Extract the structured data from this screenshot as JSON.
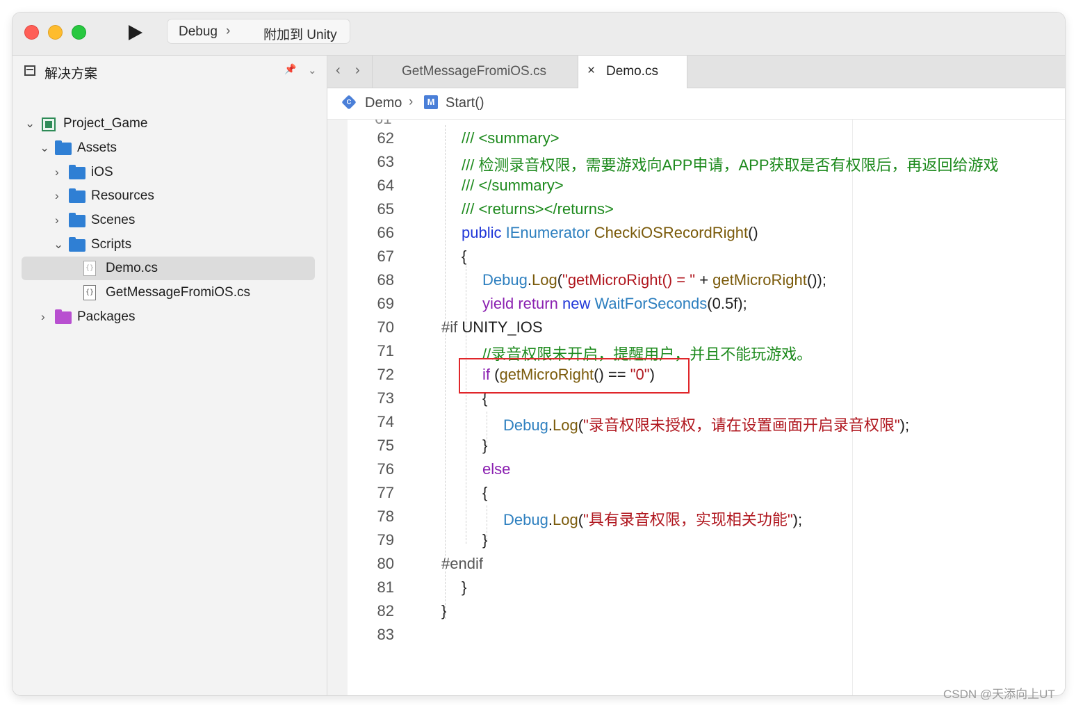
{
  "toolbar": {
    "configuration": "Debug",
    "separator": "›",
    "target": "附加到 Unity"
  },
  "sidebar": {
    "title": "解决方案",
    "tree": [
      {
        "label": "Project_Game",
        "kind": "project",
        "expanded": true
      },
      {
        "label": "Assets",
        "kind": "folder",
        "expanded": true
      },
      {
        "label": "iOS",
        "kind": "folder",
        "expanded": false
      },
      {
        "label": "Resources",
        "kind": "folder",
        "expanded": false
      },
      {
        "label": "Scenes",
        "kind": "folder",
        "expanded": false
      },
      {
        "label": "Scripts",
        "kind": "folder",
        "expanded": true
      },
      {
        "label": "Demo.cs",
        "kind": "file",
        "selected": true
      },
      {
        "label": "GetMessageFromiOS.cs",
        "kind": "file"
      },
      {
        "label": "Packages",
        "kind": "package",
        "expanded": false
      }
    ]
  },
  "tabs": [
    {
      "label": "GetMessageFromiOS.cs",
      "active": false
    },
    {
      "label": "Demo.cs",
      "active": true,
      "close": "×"
    }
  ],
  "breadcrumb": {
    "class_icon": "C",
    "class_name": "Demo",
    "method_icon": "M",
    "method_name": "Start()"
  },
  "code": {
    "lines": [
      {
        "n": "62",
        "text": "/// <summary>"
      },
      {
        "n": "63",
        "text": "/// 检测录音权限，需要游戏向APP申请，APP获取是否有权限后，再返回给游戏"
      },
      {
        "n": "64",
        "text": "/// </summary>"
      },
      {
        "n": "65",
        "text": "/// <returns></returns>"
      },
      {
        "n": "66",
        "text": "public IEnumerator CheckiOSRecordRight()"
      },
      {
        "n": "67",
        "text": "{"
      },
      {
        "n": "68",
        "text": "Debug.Log(\"getMicroRight() = \" + getMicroRight());"
      },
      {
        "n": "69",
        "text": "yield return new WaitForSeconds(0.5f);"
      },
      {
        "n": "70",
        "text": "#if UNITY_IOS"
      },
      {
        "n": "71",
        "text": "//录音权限未开启，提醒用户，并且不能玩游戏。"
      },
      {
        "n": "72",
        "text": "if (getMicroRight() == \"0\")"
      },
      {
        "n": "73",
        "text": "{"
      },
      {
        "n": "74",
        "text": "Debug.Log(\"录音权限未授权，请在设置画面开启录音权限\");"
      },
      {
        "n": "75",
        "text": "}"
      },
      {
        "n": "76",
        "text": "else"
      },
      {
        "n": "77",
        "text": "{"
      },
      {
        "n": "78",
        "text": "Debug.Log(\"具有录音权限，实现相关功能\");"
      },
      {
        "n": "79",
        "text": "}"
      },
      {
        "n": "80",
        "text": "#endif"
      },
      {
        "n": "81",
        "text": "}"
      },
      {
        "n": "82",
        "text": "}"
      },
      {
        "n": "83",
        "text": ""
      }
    ]
  },
  "tokens": {
    "l62": "/// <summary>",
    "l63": "/// 检测录音权限，需要游戏向APP申请，APP获取是否有权限后，再返回给游戏",
    "l64": "/// </summary>",
    "l65": "/// <returns></returns>",
    "l66_kw": "public",
    "l66_type": "IEnumerator",
    "l66_meth": "CheckiOSRecordRight",
    "l66_rest": "()",
    "l67": "{",
    "l68_type": "Debug",
    "l68_dot": ".",
    "l68_meth": "Log",
    "l68_p": "(",
    "l68_str": "\"getMicroRight() = \"",
    "l68_plus": " + ",
    "l68_meth2": "getMicroRight",
    "l68_end": "());",
    "l69_kw": "yield return",
    "l69_new": "new",
    "l69_type": "WaitForSeconds",
    "l69_end": "(0.5f);",
    "l70_pre": "#if",
    "l70_sym": " UNITY_IOS",
    "l71": "//录音权限未开启，提醒用户，并且不能玩游戏。",
    "l72_kw": "if",
    "l72_p": " (",
    "l72_meth": "getMicroRight",
    "l72_mid": "() == ",
    "l72_str": "\"0\"",
    "l72_end": ")",
    "l73": "{",
    "l74_type": "Debug",
    "l74_dot": ".",
    "l74_meth": "Log",
    "l74_p": "(",
    "l74_str": "\"录音权限未授权，请在设置画面开启录音权限\"",
    "l74_end": ");",
    "l75": "}",
    "l76_kw": "else",
    "l77": "{",
    "l78_type": "Debug",
    "l78_dot": ".",
    "l78_meth": "Log",
    "l78_p": "(",
    "l78_str": "\"具有录音权限，实现相关功能\"",
    "l78_end": ");",
    "l79": "}",
    "l80": "#endif",
    "l81": "}",
    "l82": "}"
  },
  "watermark": "CSDN @天添向上UT",
  "colors": {
    "comment": "#1d8a1d",
    "keyword": "#8a1fb0",
    "keyword_blue": "#1f36d8",
    "type": "#2d7fbf",
    "method": "#7a5a0a",
    "string": "#b0171f",
    "highlight_box": "#e0262a"
  }
}
